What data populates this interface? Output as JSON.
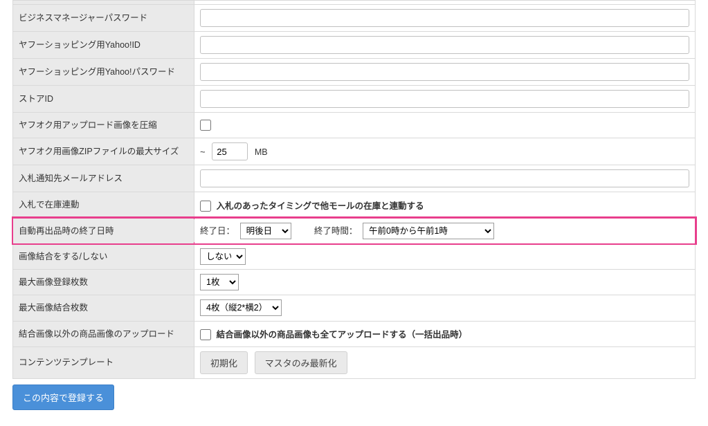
{
  "rows": {
    "biz_mgr_pw": {
      "label": "ビジネスマネージャーパスワード",
      "value": ""
    },
    "yshop_yid": {
      "label": "ヤフーショッピング用Yahoo!ID",
      "value": ""
    },
    "yshop_ypw": {
      "label": "ヤフーショッピング用Yahoo!パスワード",
      "value": ""
    },
    "store_id": {
      "label": "ストアID",
      "value": ""
    },
    "yauc_img_compress": {
      "label": "ヤフオク用アップロード画像を圧縮"
    },
    "yauc_zip_max": {
      "label": "ヤフオク用画像ZIPファイルの最大サイズ",
      "prefix": "~",
      "value": "25",
      "unit": "MB"
    },
    "bid_notify_mail": {
      "label": "入札通知先メールアドレス",
      "value": ""
    },
    "bid_stock_link": {
      "label": "入札で在庫連動",
      "cb_label": "入札のあったタイミングで他モールの在庫と連動する"
    },
    "auto_relist_end": {
      "label": "自動再出品時の終了日時",
      "end_day_label": "終了日：",
      "end_day_value": "明後日",
      "end_time_label": "終了時間：",
      "end_time_value": "午前0時から午前1時"
    },
    "img_merge": {
      "label": "画像結合をする/しない",
      "value": "しない"
    },
    "max_img_count": {
      "label": "最大画像登録枚数",
      "value": "1枚"
    },
    "max_merge_count": {
      "label": "最大画像結合枚数",
      "value": "4枚（縦2*横2）"
    },
    "non_merge_upload": {
      "label": "結合画像以外の商品画像のアップロード",
      "cb_label": "結合画像以外の商品画像も全てアップロードする（一括出品時）"
    },
    "content_tpl": {
      "label": "コンテンツテンプレート",
      "btn_init": "初期化",
      "btn_latest": "マスタのみ最新化"
    }
  },
  "submit_label": "この内容で登録する"
}
